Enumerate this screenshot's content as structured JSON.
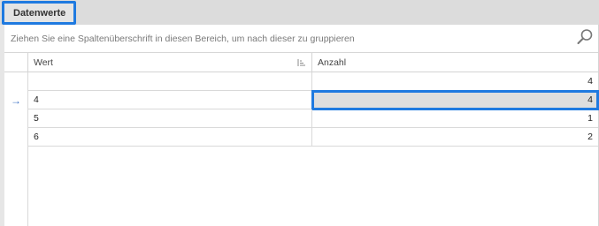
{
  "tabs": [
    {
      "label": "Datenwerte",
      "active": true
    }
  ],
  "group_panel": {
    "hint": "Ziehen Sie eine Spaltenüberschrift in diesen Bereich, um nach dieser zu gruppieren"
  },
  "columns": {
    "wert": "Wert",
    "anzahl": "Anzahl"
  },
  "rows": [
    {
      "wert": "",
      "anzahl": "4",
      "current": false
    },
    {
      "wert": "4",
      "anzahl": "4",
      "current": true
    },
    {
      "wert": "5",
      "anzahl": "1",
      "current": false
    },
    {
      "wert": "6",
      "anzahl": "2",
      "current": false
    }
  ],
  "icons": {
    "search": "search-icon",
    "sort": "sort-icon",
    "row_indicator": "arrow-right-icon"
  },
  "colors": {
    "accent": "#1f7ae0",
    "focused_cell": "#dedede"
  }
}
